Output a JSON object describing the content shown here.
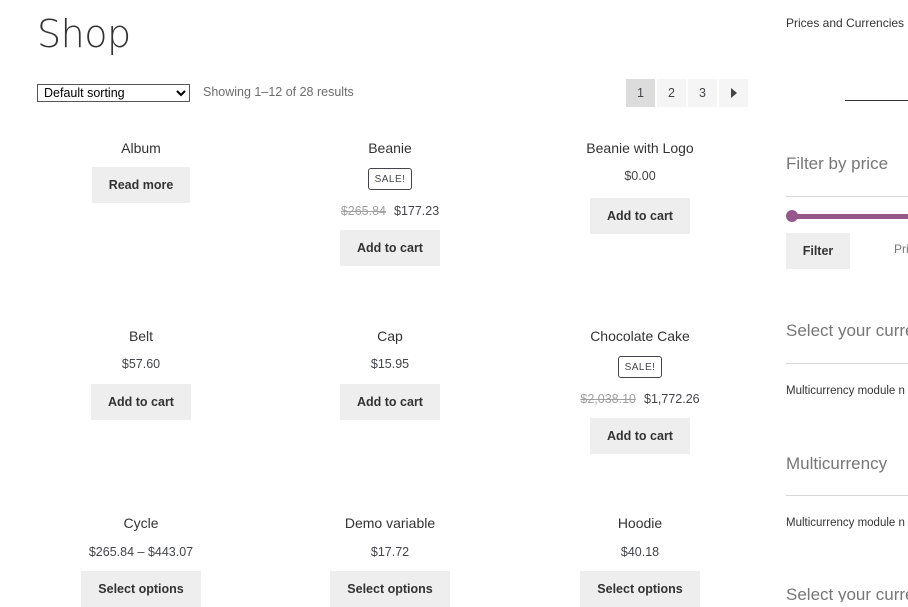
{
  "page_title": "Shop",
  "toolbar": {
    "sorting_selected": "Default sorting",
    "result_count": "Showing 1–12 of 28 results"
  },
  "pagination": {
    "pages": [
      "1",
      "2",
      "3"
    ],
    "current": "1",
    "next_icon": "triangle-right-icon"
  },
  "products": [
    {
      "title": "Album",
      "button": "Read more"
    },
    {
      "title": "Beanie",
      "sale": "SALE!",
      "old_price": "$265.84",
      "price": "$177.23",
      "button": "Add to cart"
    },
    {
      "title": "Beanie with Logo",
      "price": "$0.00",
      "button": "Add to cart"
    },
    {
      "title": "Belt",
      "price": "$57.60",
      "button": "Add to cart"
    },
    {
      "title": "Cap",
      "price": "$15.95",
      "button": "Add to cart"
    },
    {
      "title": "Chocolate Cake",
      "sale": "SALE!",
      "old_price": "$2,038.10",
      "price": "$1,772.26",
      "button": "Add to cart"
    },
    {
      "title": "Cycle",
      "price": "$265.84 – $443.07",
      "button": "Select options"
    },
    {
      "title": "Demo variable",
      "price": "$17.72",
      "button": "Select options"
    },
    {
      "title": "Hoodie",
      "price": "$40.18",
      "button": "Select options"
    }
  ],
  "sidebar": {
    "notice": "Prices and Currencies b module not enabled!",
    "filter_heading": "Filter by price",
    "filter_button": "Filter",
    "price_label": "Pri",
    "currency_heading_1": "Select your curre",
    "multicurrency_note_1": "Multicurrency module n",
    "multicurrency_heading": "Multicurrency",
    "multicurrency_note_2": "Multicurrency module n",
    "currency_heading_2": "Select your curre",
    "accent_color": "#96588a"
  }
}
